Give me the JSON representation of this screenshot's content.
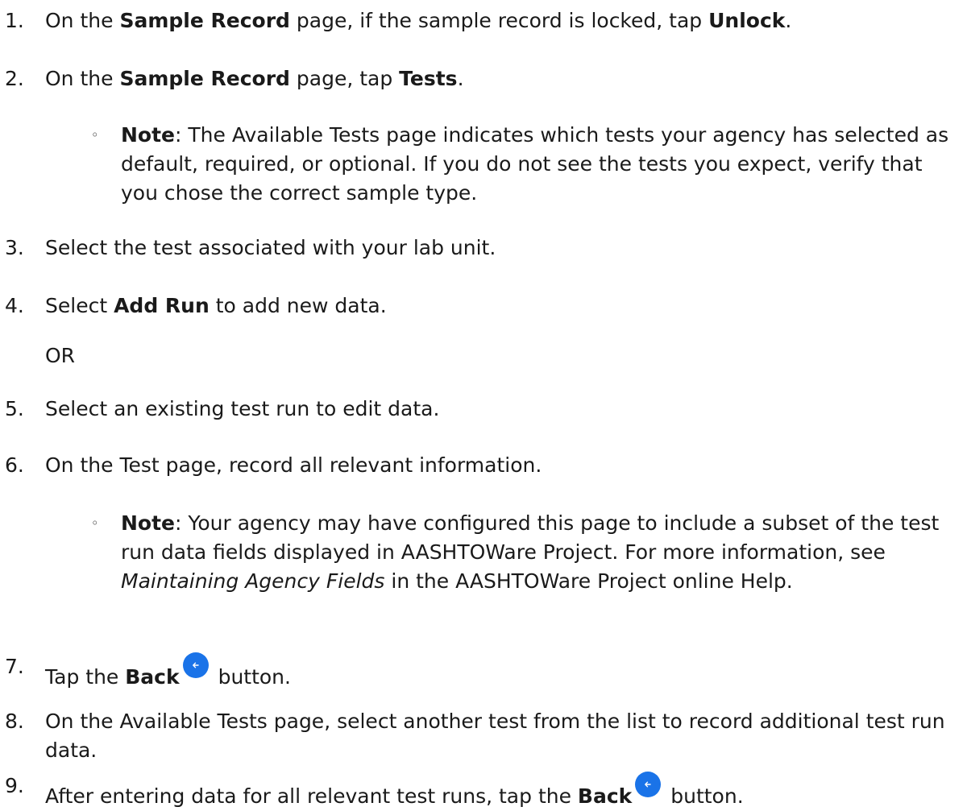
{
  "steps": [
    {
      "num": "1.",
      "a": "On the ",
      "b1": "Sample Record",
      "c": " page, if the sample record is locked, tap ",
      "b2": "Unlock",
      "d": "."
    },
    {
      "num": "2.",
      "a": "On the ",
      "b1": "Sample Record",
      "c": " page, tap ",
      "b2": "Tests",
      "d": "."
    },
    {
      "num": "3.",
      "text": "Select the test associated with your lab unit."
    },
    {
      "num": "4.",
      "a": "Select ",
      "b1": "Add Run",
      "c": " to add new data."
    },
    {
      "num": "5.",
      "text": "Select an existing test run to edit data."
    },
    {
      "num": "6.",
      "text": "On the Test page, record all relevant information."
    },
    {
      "num": "7.",
      "a": "Tap the ",
      "b1": "Back",
      "c": " button."
    },
    {
      "num": "8.",
      "text": "On the Available Tests page, select another test from the list to record additional test run data."
    },
    {
      "num": "9.",
      "a": "After entering data for all relevant test runs, tap the ",
      "b1": "Back",
      "c": " button."
    }
  ],
  "or_text": "OR",
  "notes": [
    {
      "bullet": "◦",
      "label": "Note",
      "text": ": The Available Tests page indicates which tests your agency has selected as default, required, or optional. If you do not see the tests you expect, verify that you chose the correct sample type."
    },
    {
      "bullet": "◦",
      "label": "Note",
      "text_a": ": Your agency may have configured this page to include a subset of the test run data fields displayed in AASHTOWare Project. For more information, see ",
      "italic": "Maintaining Agency Fields",
      "text_b": " in the AASHTOWare Project online Help."
    }
  ],
  "icons": {
    "back": "back-arrow-icon",
    "back_color": "#1a73e8"
  }
}
